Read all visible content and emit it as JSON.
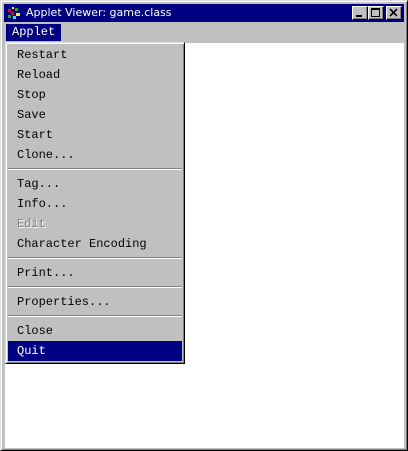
{
  "window": {
    "title": "Applet Viewer: game.class"
  },
  "menubar": {
    "applet_label": "Applet"
  },
  "menu": {
    "restart": "Restart",
    "reload": "Reload",
    "stop": "Stop",
    "save": "Save",
    "start": "Start",
    "clone": "Clone...",
    "tag": "Tag...",
    "info": "Info...",
    "edit": "Edit",
    "character_encoding": "Character Encoding",
    "print": "Print...",
    "properties": "Properties...",
    "close": "Close",
    "quit": "Quit"
  },
  "colors": {
    "title_bar": "#000080",
    "selection": "#000080",
    "face": "#c0c0c0",
    "content_bg": "#ffffff"
  },
  "icons": {
    "app": "java-applet-icon",
    "minimize": "minimize-icon",
    "maximize": "maximize-icon",
    "close": "close-icon"
  }
}
